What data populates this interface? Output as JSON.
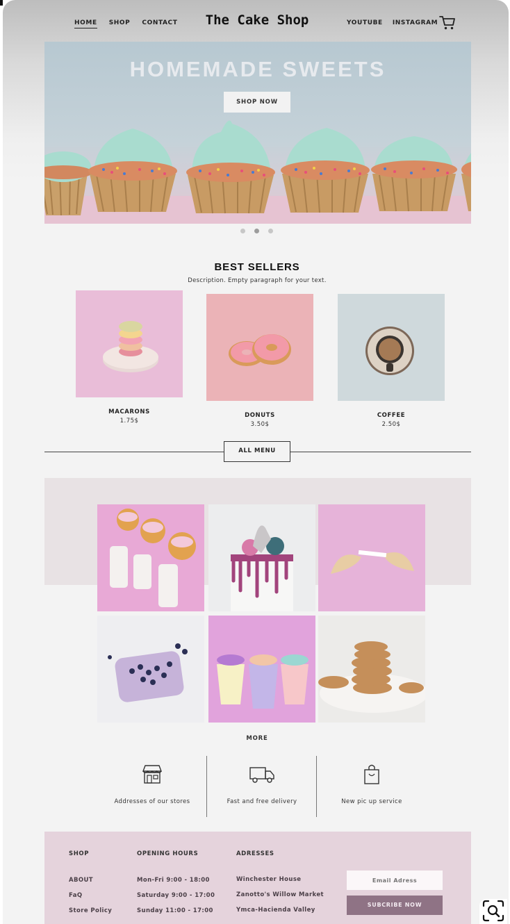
{
  "header": {
    "nav_left": [
      "HOME",
      "SHOP",
      "CONTACT"
    ],
    "brand": "The Cake Shop",
    "nav_right": [
      "YOUTUBE",
      "INSTAGRAM"
    ],
    "cart_icon": "cart-icon"
  },
  "hero": {
    "title": "HOMEMADE SWEETS",
    "button": "SHOP NOW",
    "slides": 3,
    "active_slide": 2
  },
  "best_sellers": {
    "title": "BEST SELLERS",
    "description": "Description. Empty paragraph for your text.",
    "products": [
      {
        "name": "MACARONS",
        "price": "1.75$"
      },
      {
        "name": "DONUTS",
        "price": "3.50$"
      },
      {
        "name": "COFFEE",
        "price": "2.50$"
      }
    ],
    "all_menu": "ALL MENU"
  },
  "gallery": {
    "more": "MORE"
  },
  "features": [
    {
      "icon": "storefront-icon",
      "label": "Addresses of our stores"
    },
    {
      "icon": "delivery-truck-icon",
      "label": "Fast and free delivery"
    },
    {
      "icon": "shopping-bag-icon",
      "label": "New pic up service"
    }
  ],
  "footer": {
    "shop": {
      "heading": "SHOP",
      "items": [
        "ABOUT",
        "FaQ",
        "Store Policy"
      ]
    },
    "hours": {
      "heading": "OPENING HOURS",
      "items": [
        "Mon-Fri 9:00 - 18:00",
        "Saturday 9:00 - 17:00",
        "Sunday 11:00 - 17:00"
      ]
    },
    "addresses": {
      "heading": "ADRESSES",
      "items": [
        "Winchester House",
        "Zanotto's Willow Market",
        "Ymca-Hacienda Valley"
      ]
    },
    "email_placeholder": "Email Adress",
    "subscribe": "SUBCRIBE NOW"
  },
  "colors": {
    "footer_bg": "#e5d3dc",
    "subscribe_bg": "#8f7385",
    "gallery_bg": "#e8e2e4"
  }
}
